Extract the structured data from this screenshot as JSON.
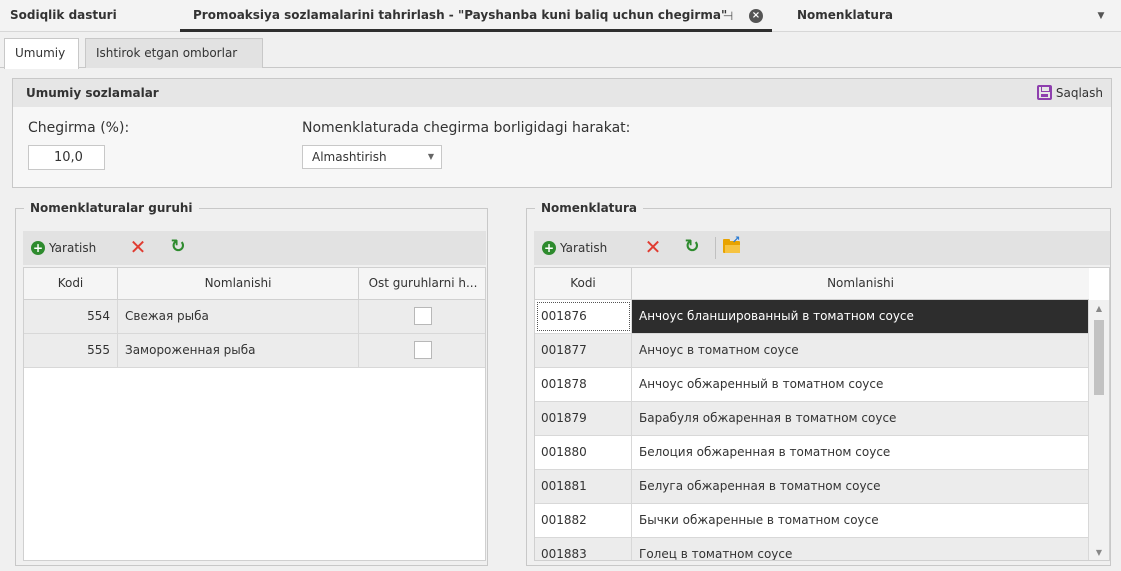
{
  "doc_tabs": {
    "tab1": "Sodiqlik dasturi",
    "tab2": "Promoaksiya sozlamalarini tahrirlash - \"Payshanba kuni baliq uchun chegirma\"",
    "tab3": "Nomenklatura"
  },
  "sub_tabs": {
    "general": "Umumiy",
    "warehouses": "Ishtirok etgan omborlar"
  },
  "settings": {
    "title": "Umumiy sozlamalar",
    "save_label": "Saqlash",
    "discount_label": "Chegirma (%):",
    "discount_value": "10,0",
    "action_label": "Nomenklaturada chegirma borligidagi harakat:",
    "action_value": "Almashtirish"
  },
  "groups_panel": {
    "title": "Nomenklaturalar guruhi",
    "create_label": "Yaratish",
    "columns": [
      "Kodi",
      "Nomlanishi",
      "Ost guruhlarni h..."
    ],
    "rows": [
      {
        "code": "554",
        "name": "Свежая рыба",
        "checked": false
      },
      {
        "code": "555",
        "name": "Замороженная рыба",
        "checked": false
      }
    ]
  },
  "items_panel": {
    "title": "Nomenklatura",
    "create_label": "Yaratish",
    "columns": [
      "Kodi",
      "Nomlanishi"
    ],
    "rows": [
      {
        "code": "001876",
        "name": "Анчоус бланшированный в томатном соусе"
      },
      {
        "code": "001877",
        "name": "Анчоус в томатном соусе"
      },
      {
        "code": "001878",
        "name": "Анчоус обжаренный в томатном соусе"
      },
      {
        "code": "001879",
        "name": "Барабуля обжаренная в томатном соусе"
      },
      {
        "code": "001880",
        "name": "Белоция обжаренная в томатном соусе"
      },
      {
        "code": "001881",
        "name": "Белуга обжаренная в томатном соусе"
      },
      {
        "code": "001882",
        "name": "Бычки обжаренные в томатном соусе"
      },
      {
        "code": "001883",
        "name": "Голец в томатном соусе"
      }
    ]
  },
  "colors": {
    "accent": "#2d2d2d",
    "create_green": "#2e8b2e",
    "delete_red": "#e03c31",
    "save_purple": "#8e3fae",
    "folder_yellow": "#e8a300"
  },
  "icons": [
    "pin-icon",
    "close-icon",
    "chevron-down-icon",
    "save-icon",
    "plus-circle-icon",
    "delete-icon",
    "refresh-icon",
    "folder-open-icon"
  ]
}
